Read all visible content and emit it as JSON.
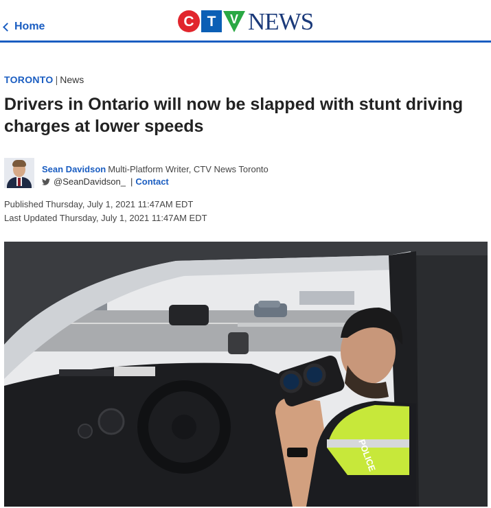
{
  "header": {
    "home_label": "Home",
    "logo_letters": [
      "C",
      "T",
      "V"
    ],
    "logo_word": "NEWS",
    "accent_color": "#1a5dc1"
  },
  "article": {
    "section": "TORONTO",
    "separator": "|",
    "subsection": "News",
    "headline": "Drivers in Ontario will now be slapped with stunt driving charges at lower speeds",
    "author": {
      "name": "Sean Davidson",
      "title": "Multi-Platform Writer, CTV News Toronto",
      "twitter_handle": "@SeanDavidson_",
      "separator": "|",
      "contact_label": "Contact"
    },
    "published": "Published Thursday, July 1, 2021 11:47AM EDT",
    "last_updated": "Last Updated Thursday, July 1, 2021 11:47AM EDT",
    "image": {
      "vest_text": "POLICE"
    }
  },
  "icons": {
    "home_chevron": "chevron-left-icon",
    "twitter": "twitter-bird-icon"
  }
}
